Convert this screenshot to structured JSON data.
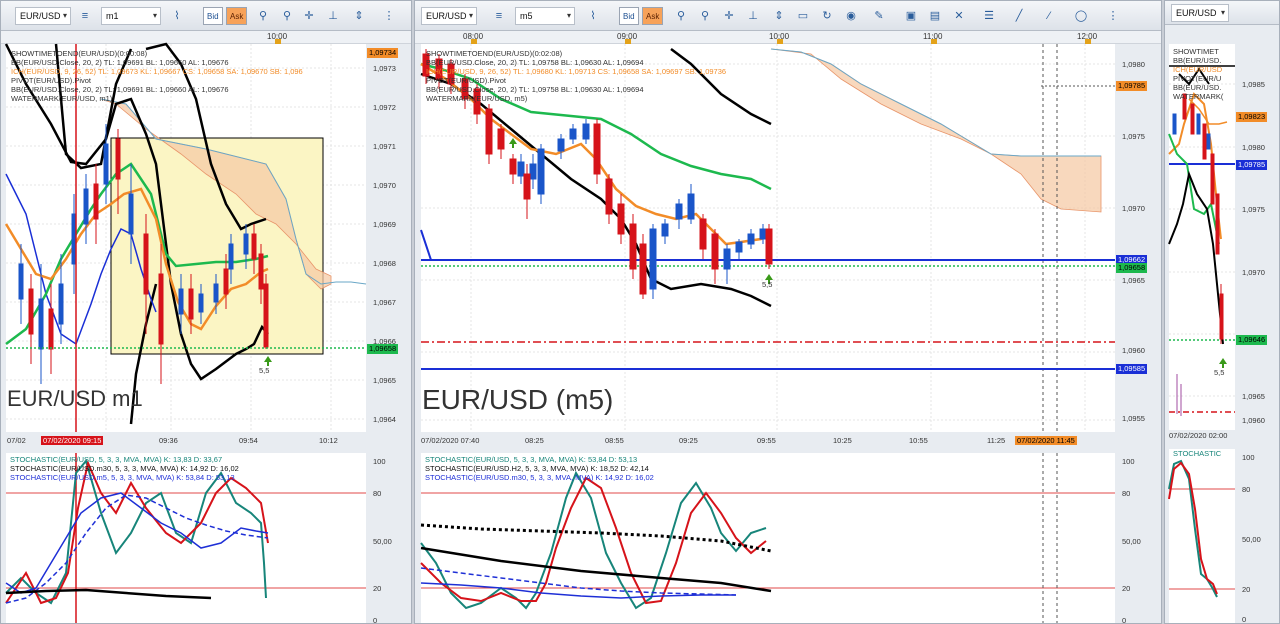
{
  "panels": [
    {
      "symbol": "EUR/USD",
      "timeframe": "m1",
      "bid_label": "Bid",
      "ask_label": "Ask",
      "top_time": "10:00",
      "legend": [
        {
          "text": "SHOWTIMETOEND(EUR/USD)(0:00:08)",
          "color": "#333"
        },
        {
          "text": "BB(EUR/USD.Close, 20, 2)  TL: 1,09691  BL: 1,09660  AL: 1,09676",
          "color": "#333"
        },
        {
          "text": "ICH(EUR/USD, 9, 26, 52)  TL: 1,09673  KL: 1,09667  CS: 1,09658  SA: 1,09670  SB: 1,096",
          "color": "#f28c28"
        },
        {
          "text": "PIVOT(EUR/USD).Pivot",
          "color": "#333"
        },
        {
          "text": "BB(EUR/USD.Close, 20, 2)  TL: 1,09691  BL: 1,09660  AL: 1,09676",
          "color": "#333"
        },
        {
          "text": "WATERMARK(EUR/USD, m1)",
          "color": "#333"
        }
      ],
      "prices": [
        "1,0973",
        "1,0972",
        "1,0971",
        "1,0970",
        "1,0969",
        "1,0968",
        "1,0967",
        "1,0966",
        "1,0965",
        "1,0964"
      ],
      "top_price_box": "1,09734",
      "current_price_box": "1,09658",
      "arrow_label": "5,5",
      "watermark": "EUR/USD m1",
      "dates": [
        "07/02/2020 09:15",
        "09:36",
        "09:54",
        "10:12"
      ],
      "date_prefix": "07/02",
      "stoch_legend": [
        {
          "text": "STOCHASTIC(EUR/USD, 5, 3, 3, MVA, MVA)  K: 13,83  D: 33,67",
          "color": "#17857a"
        },
        {
          "text": "STOCHASTIC(EUR/USD.m30, 5, 3, 3, MVA, MVA)  K: 14,92  D: 16,02",
          "color": "#111"
        },
        {
          "text": "STOCHASTIC(EUR/USD.m5, 5, 3, 3, MVA, MVA)  K: 53,84  D: 53,13",
          "color": "#1e2fd6"
        }
      ],
      "stoch_levels": [
        "100",
        "80",
        "50,00",
        "20",
        "0"
      ]
    },
    {
      "symbol": "EUR/USD",
      "timeframe": "m5",
      "bid_label": "Bid",
      "ask_label": "Ask",
      "top_times": [
        "08:00",
        "09:00",
        "10:00",
        "11:00",
        "12:00"
      ],
      "legend": [
        {
          "text": "SHOWTIMETOEND(EUR/USD)(0:02:08)",
          "color": "#333"
        },
        {
          "text": "BB(EUR/USD.Close, 20, 2)  TL: 1,09758  BL: 1,09630  AL: 1,09694",
          "color": "#333"
        },
        {
          "text": "ICH(EUR/USD, 9, 26, 52)  TL: 1,09680  KL: 1,09713  CS: 1,09658  SA: 1,09697  SB: 1,09736",
          "color": "#f28c28"
        },
        {
          "text": "PIVOT(EUR/USD).Pivot",
          "color": "#333"
        },
        {
          "text": "BB(EUR/USD.Close, 20, 2)  TL: 1,09758  BL: 1,09630  AL: 1,09694",
          "color": "#333"
        },
        {
          "text": "WATERMARK(EUR/USD, m5)",
          "color": "#333"
        }
      ],
      "prices": [
        "1,0980",
        "1,0975",
        "1,0970",
        "1,0965",
        "1,0960",
        "1,0955"
      ],
      "boxes": {
        "orange": "1,09785",
        "blue1": "1,09662",
        "green": "1,09658",
        "blue2": "1,09585"
      },
      "arrow_label": "5,5",
      "watermark": "EUR/USD (m5)",
      "dates": [
        "07/02/2020 07:40",
        "08:25",
        "08:55",
        "09:25",
        "09:55",
        "10:25",
        "10:55",
        "11:25"
      ],
      "date_box": "07/02/2020 11:45",
      "stoch_legend": [
        {
          "text": "STOCHASTIC(EUR/USD, 5, 3, 3, MVA, MVA)  K: 53,84  D: 53,13",
          "color": "#17857a"
        },
        {
          "text": "STOCHASTIC(EUR/USD.H2, 5, 3, 3, MVA, MVA)  K: 18,52  D: 42,14",
          "color": "#111"
        },
        {
          "text": "STOCHASTIC(EUR/USD.m30, 5, 3, 3, MVA, MVA)  K: 14,92  D: 16,02",
          "color": "#1e2fd6"
        }
      ],
      "stoch_levels": [
        "100",
        "80",
        "50,00",
        "20",
        "0"
      ]
    },
    {
      "symbol": "EUR/USD",
      "legend": [
        {
          "text": "SHOWTIMET",
          "color": "#333"
        },
        {
          "text": "BB(EUR/USD.",
          "color": "#333"
        },
        {
          "text": "ICH(EUR/USD",
          "color": "#f28c28"
        },
        {
          "text": "PIVOT(EUR/U",
          "color": "#333"
        },
        {
          "text": "BB(EUR/USD.",
          "color": "#333"
        },
        {
          "text": "WATERMARK(",
          "color": "#333"
        }
      ],
      "prices": [
        "1,0985",
        "1,0980",
        "1,0975",
        "1,0970",
        "1,0965",
        "1,0960"
      ],
      "boxes": {
        "orange": "1,09823",
        "blue": "1,09785",
        "green": "1,09646"
      },
      "arrow_label": "5,5",
      "date": "07/02/2020 02:00",
      "stoch_title": "STOCHASTIC",
      "stoch_levels": [
        "100",
        "80",
        "50,00",
        "20",
        "0"
      ]
    }
  ]
}
